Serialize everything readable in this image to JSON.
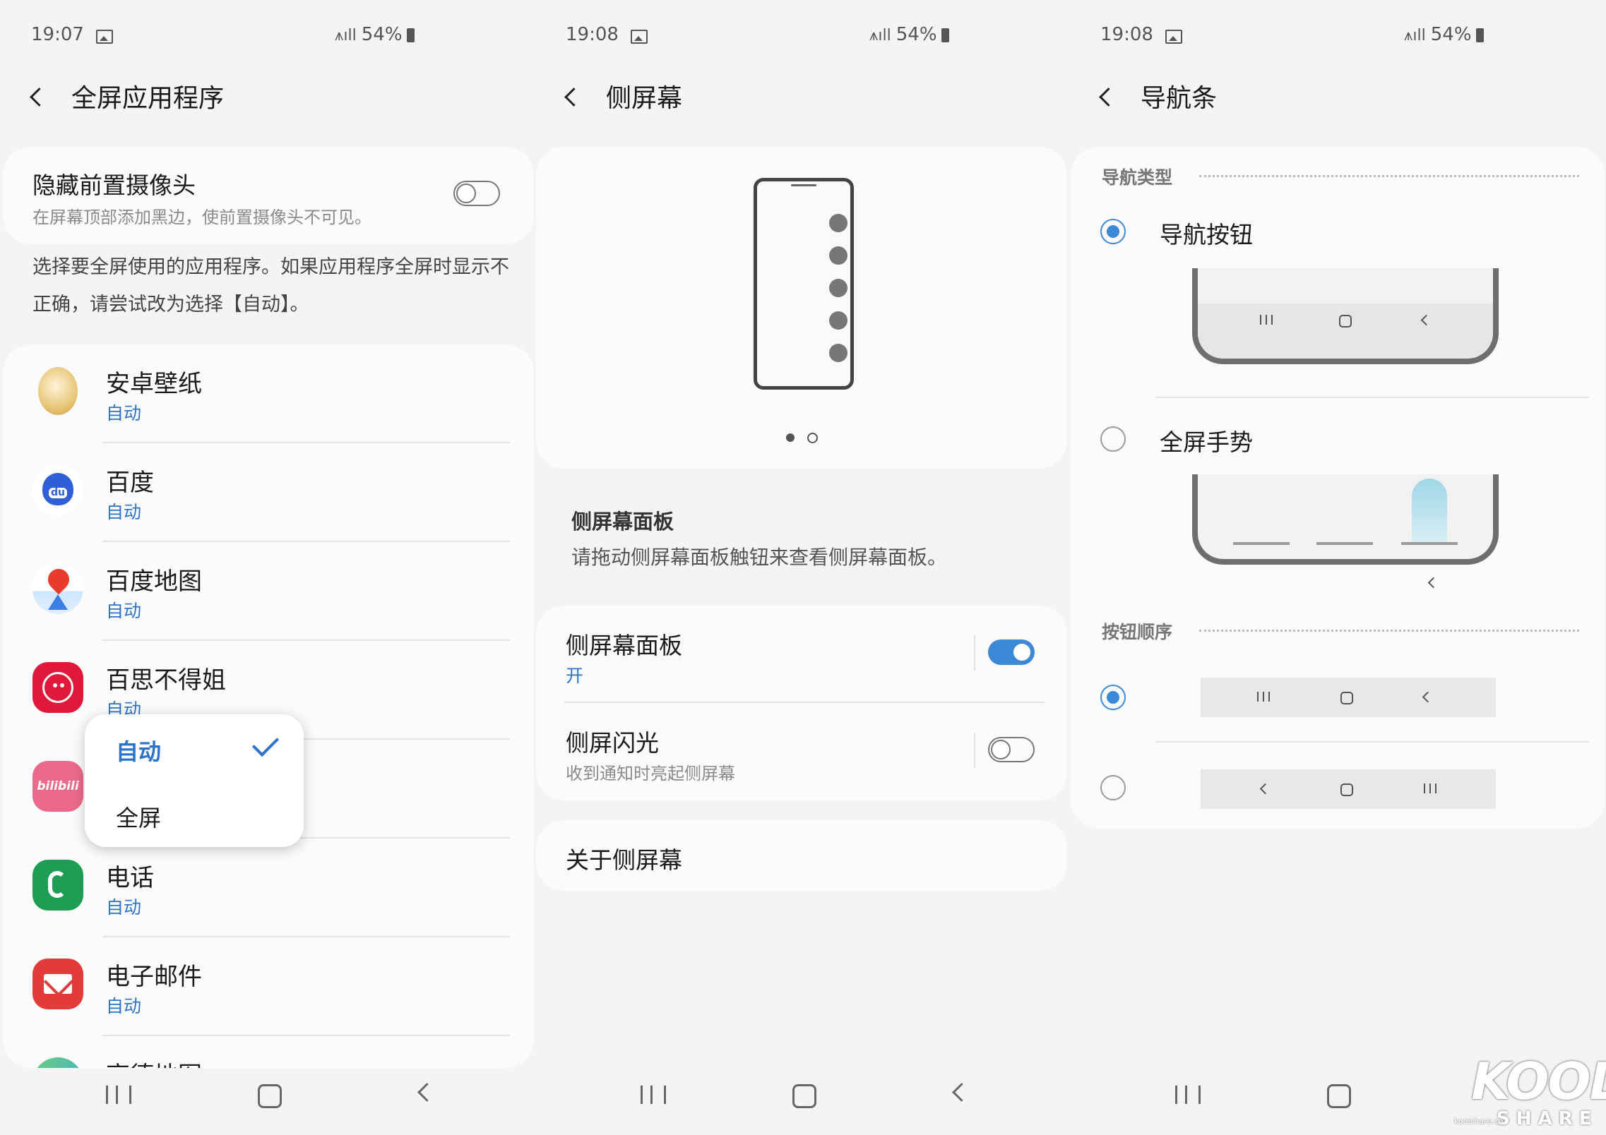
{
  "panel1": {
    "status": {
      "time": "19:07",
      "signal": "54%"
    },
    "title": "全屏应用程序",
    "hide_camera": {
      "title": "隐藏前置摄像头",
      "subtitle": "在屏幕顶部添加黑边，使前置摄像头不可见。",
      "enabled": false
    },
    "description": "选择要全屏使用的应用程序。如果应用程序全屏时显示不正确，请尝试改为选择【自动】。",
    "apps": [
      {
        "name": "安卓壁纸",
        "mode": "自动",
        "icon": "egg-icon"
      },
      {
        "name": "百度",
        "mode": "自动",
        "icon": "baidu-icon"
      },
      {
        "name": "百度地图",
        "mode": "自动",
        "icon": "baidu-map-icon"
      },
      {
        "name": "百思不得姐",
        "mode": "自动",
        "icon": "budejie-icon"
      },
      {
        "name": "",
        "mode": "",
        "icon": "bilibili-icon",
        "icon_text": "bilibili"
      },
      {
        "name": "电话",
        "mode": "自动",
        "icon": "phone-icon"
      },
      {
        "name": "电子邮件",
        "mode": "自动",
        "icon": "email-icon"
      },
      {
        "name": "高德地图",
        "mode": "",
        "icon": "amap-icon"
      }
    ],
    "dropdown": {
      "options": [
        "自动",
        "全屏"
      ],
      "selected": "自动"
    }
  },
  "panel2": {
    "status": {
      "time": "19:08",
      "signal": "54%"
    },
    "title": "侧屏幕",
    "page_indicator": {
      "pages": 2,
      "current": 1
    },
    "panel_intro": {
      "title": "侧屏幕面板",
      "desc": "请拖动侧屏幕面板触钮来查看侧屏幕面板。"
    },
    "edge_panels": {
      "title": "侧屏幕面板",
      "status": "开",
      "enabled": true
    },
    "edge_lighting": {
      "title": "侧屏闪光",
      "subtitle": "收到通知时亮起侧屏幕",
      "enabled": false
    },
    "about": "关于侧屏幕"
  },
  "panel3": {
    "status": {
      "time": "19:08",
      "signal": "54%"
    },
    "title": "导航条",
    "nav_type_header": "导航类型",
    "nav_buttons": "导航按钮",
    "fullscreen_gestures": "全屏手势",
    "nav_type_selected": "导航按钮",
    "button_order_header": "按钮顺序",
    "button_order_selected": 0
  },
  "watermark": {
    "main": "KOOL",
    "sub": "S H A R E",
    "small": "koolshare.cn"
  },
  "colors": {
    "accent": "#3e88d8",
    "background": "#f4f4f4",
    "card": "#fbfbfb",
    "link_blue": "#2d73c9"
  }
}
